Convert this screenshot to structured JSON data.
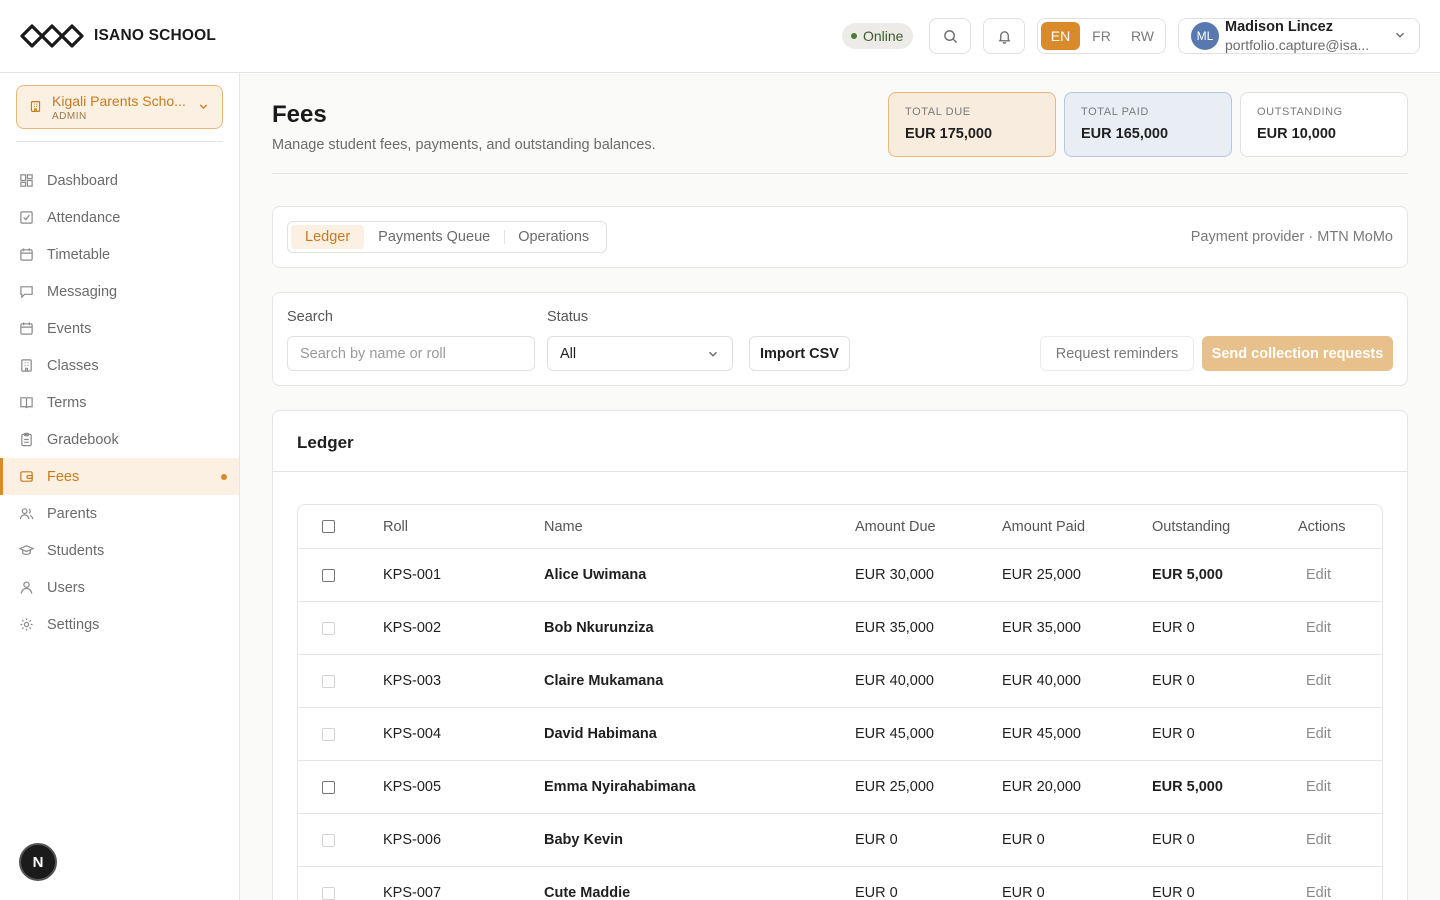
{
  "brand": {
    "name": "ISANO SCHOOL"
  },
  "header": {
    "status": "Online",
    "languages": [
      "EN",
      "FR",
      "RW"
    ],
    "active_language": "EN",
    "user": {
      "initials": "ML",
      "name": "Madison Lincez",
      "email": "portfolio.capture@isa..."
    }
  },
  "sidebar": {
    "school": {
      "name": "Kigali Parents Scho...",
      "role": "ADMIN"
    },
    "items": [
      {
        "label": "Dashboard",
        "icon": "grid-icon"
      },
      {
        "label": "Attendance",
        "icon": "check-square-icon"
      },
      {
        "label": "Timetable",
        "icon": "calendar-icon"
      },
      {
        "label": "Messaging",
        "icon": "message-icon"
      },
      {
        "label": "Events",
        "icon": "calendar-icon"
      },
      {
        "label": "Classes",
        "icon": "building-icon"
      },
      {
        "label": "Terms",
        "icon": "book-icon"
      },
      {
        "label": "Gradebook",
        "icon": "clipboard-icon"
      },
      {
        "label": "Fees",
        "icon": "wallet-icon",
        "active": true
      },
      {
        "label": "Parents",
        "icon": "users-icon"
      },
      {
        "label": "Students",
        "icon": "graduation-cap-icon"
      },
      {
        "label": "Users",
        "icon": "user-icon"
      },
      {
        "label": "Settings",
        "icon": "gear-icon"
      }
    ],
    "badge": "N"
  },
  "page": {
    "title": "Fees",
    "subtitle": "Manage student fees, payments, and outstanding balances.",
    "stats": [
      {
        "label": "TOTAL DUE",
        "value": "EUR 175,000"
      },
      {
        "label": "TOTAL PAID",
        "value": "EUR 165,000"
      },
      {
        "label": "OUTSTANDING",
        "value": "EUR 10,000"
      }
    ]
  },
  "tabs": {
    "items": [
      "Ledger",
      "Payments Queue",
      "Operations"
    ],
    "active": "Ledger",
    "provider": "Payment provider · MTN MoMo"
  },
  "filters": {
    "search_label": "Search",
    "search_placeholder": "Search by name or roll",
    "status_label": "Status",
    "status_value": "All",
    "import_label": "Import CSV",
    "reminders_label": "Request reminders",
    "send_label": "Send collection requests"
  },
  "ledger": {
    "title": "Ledger",
    "columns": [
      "Roll",
      "Name",
      "Amount Due",
      "Amount Paid",
      "Outstanding",
      "Actions"
    ],
    "rows": [
      {
        "roll": "KPS-001",
        "name": "Alice Uwimana",
        "due": "EUR 30,000",
        "paid": "EUR 25,000",
        "outstanding": "EUR 5,000",
        "action": "Edit",
        "selectable": true
      },
      {
        "roll": "KPS-002",
        "name": "Bob Nkurunziza",
        "due": "EUR 35,000",
        "paid": "EUR 35,000",
        "outstanding": "EUR 0",
        "action": "Edit",
        "selectable": false
      },
      {
        "roll": "KPS-003",
        "name": "Claire Mukamana",
        "due": "EUR 40,000",
        "paid": "EUR 40,000",
        "outstanding": "EUR 0",
        "action": "Edit",
        "selectable": false
      },
      {
        "roll": "KPS-004",
        "name": "David Habimana",
        "due": "EUR 45,000",
        "paid": "EUR 45,000",
        "outstanding": "EUR 0",
        "action": "Edit",
        "selectable": false
      },
      {
        "roll": "KPS-005",
        "name": "Emma Nyirahabimana",
        "due": "EUR 25,000",
        "paid": "EUR 20,000",
        "outstanding": "EUR 5,000",
        "action": "Edit",
        "selectable": true
      },
      {
        "roll": "KPS-006",
        "name": "Baby Kevin",
        "due": "EUR 0",
        "paid": "EUR 0",
        "outstanding": "EUR 0",
        "action": "Edit",
        "selectable": false
      },
      {
        "roll": "KPS-007",
        "name": "Cute Maddie",
        "due": "EUR 0",
        "paid": "EUR 0",
        "outstanding": "EUR 0",
        "action": "Edit",
        "selectable": false
      }
    ]
  }
}
